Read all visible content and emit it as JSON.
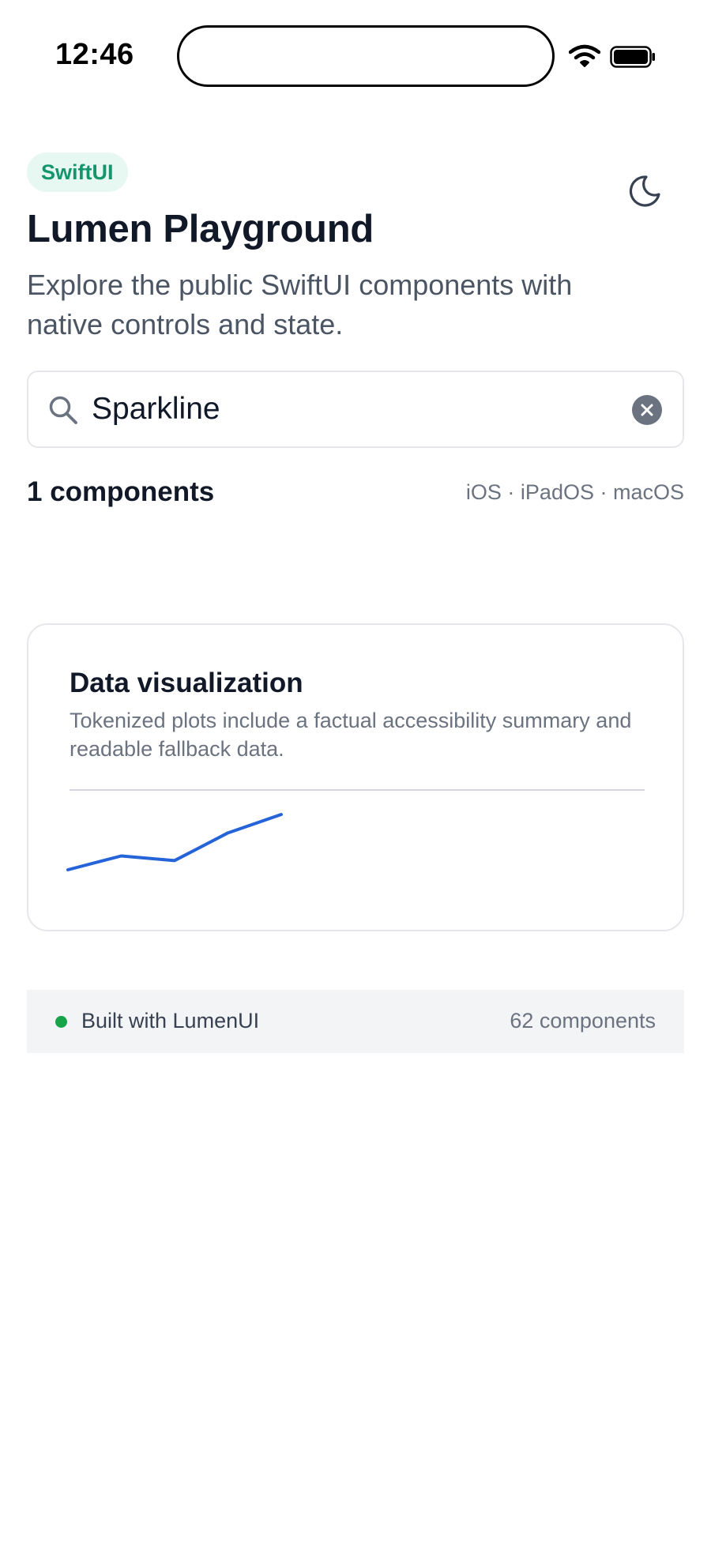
{
  "status_bar": {
    "time": "12:46",
    "icons": [
      "wifi-icon",
      "battery-icon"
    ]
  },
  "header": {
    "badge": "SwiftUI",
    "title": "Lumen Playground",
    "subtitle": "Explore the public SwiftUI components with native controls and state.",
    "theme_toggle_icon": "moon-icon"
  },
  "search": {
    "value": "Sparkline",
    "icon": "search-icon",
    "clear_icon": "clear-icon"
  },
  "results": {
    "count_label": "1 components",
    "platforms": "iOS · iPadOS · macOS"
  },
  "card": {
    "title": "Data visualization",
    "description": "Tokenized plots include a factual accessibility summary and readable fallback data.",
    "sparkline_color": "#2563d8",
    "chart_data": {
      "type": "line",
      "series": [
        {
          "values": [
            1,
            2.5,
            2,
            5,
            7
          ]
        }
      ],
      "grid": false
    }
  },
  "footer": {
    "status_color": "#16a34a",
    "left_label": "Built with LumenUI",
    "right_label": "62 components"
  },
  "colors": {
    "accent": "#14966d",
    "badge_bg": "#e7f7f1"
  }
}
